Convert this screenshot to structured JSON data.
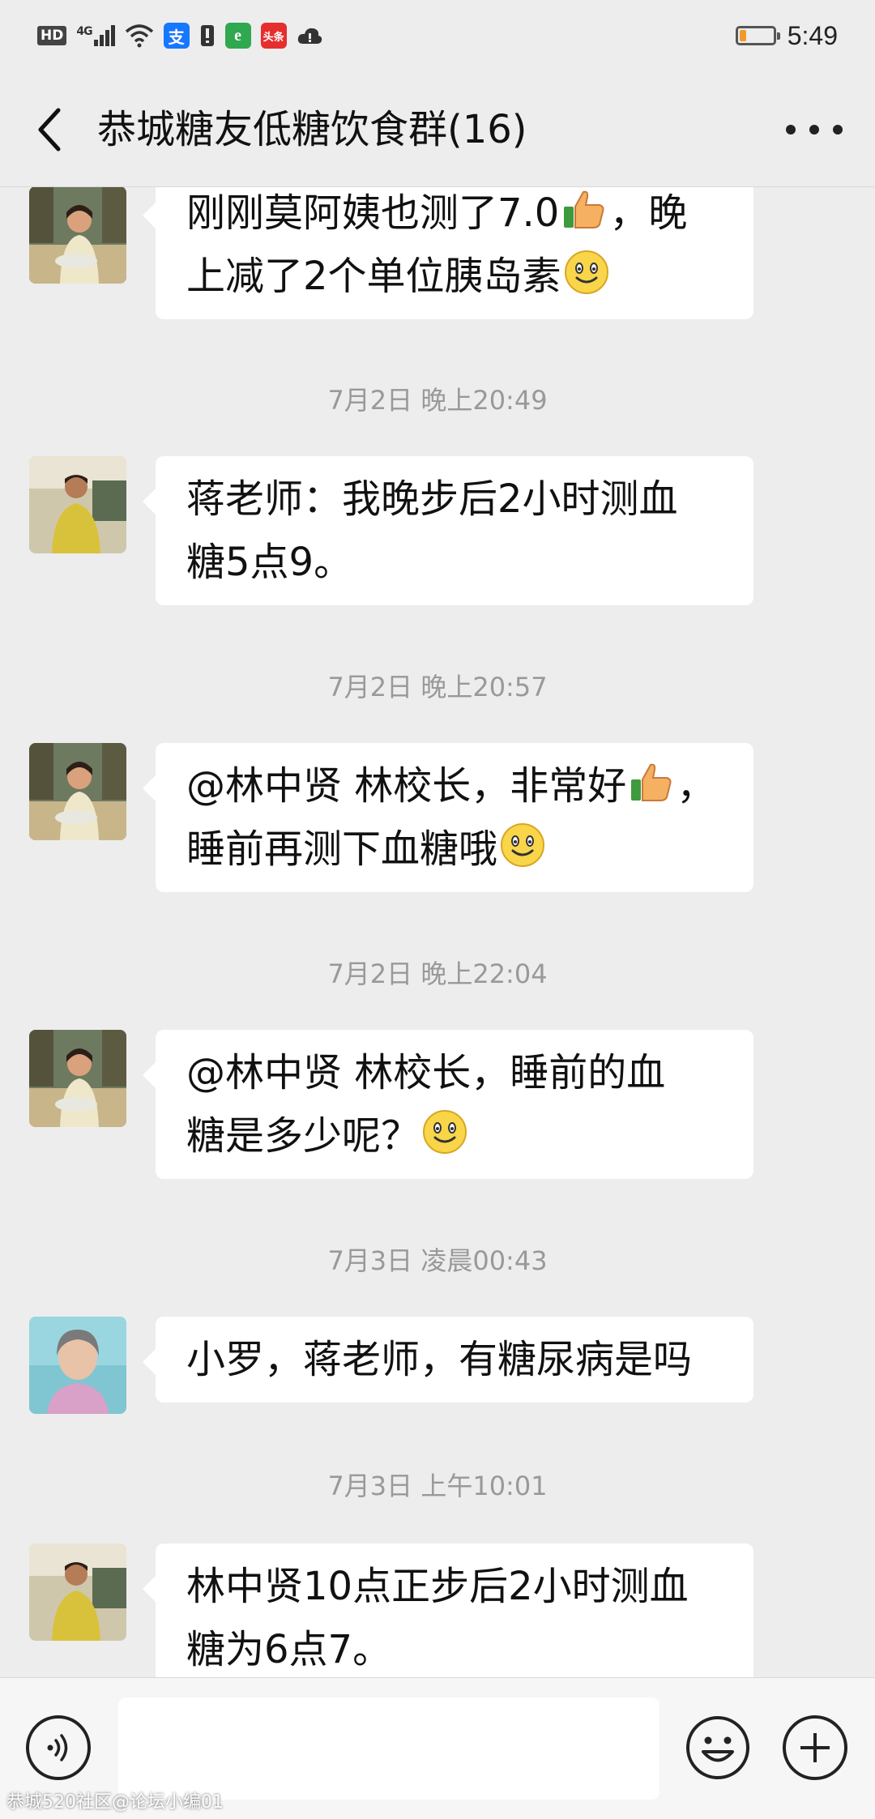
{
  "status_bar": {
    "hd": "HD",
    "network": "4G",
    "alipay_glyph": "支",
    "toutiao": "头条",
    "time": "5:49",
    "battery_level": 0.2,
    "icons": [
      "hd-icon",
      "signal-icon",
      "wifi-icon",
      "alipay-icon",
      "sim-icon",
      "browser-icon",
      "toutiao-icon",
      "cloud-icon",
      "battery-icon"
    ]
  },
  "header": {
    "title": "恭城糖友低糖饮食群(16)",
    "back_icon": "chevron-left-icon",
    "more_icon": "more-dots-icon"
  },
  "messages": [
    {
      "lines": [
        "刚刚莫阿姨也测了7.0",
        "，晚",
        "上减了2个单位胰岛素"
      ],
      "avatar": "woman-in-kitchen"
    },
    {
      "timestamp": "7月2日 晚上20:49"
    },
    {
      "lines": [
        "蒋老师：我晚步后2小时测血",
        "糖5点9。"
      ],
      "avatar": "man-yellow-shirt"
    },
    {
      "timestamp": "7月2日 晚上20:57"
    },
    {
      "lines": [
        "@林中贤  林校长，非常好",
        "，",
        "睡前再测下血糖哦"
      ],
      "avatar": "woman-in-kitchen"
    },
    {
      "timestamp": "7月2日 晚上22:04"
    },
    {
      "lines": [
        "@林中贤  林校长，睡前的血",
        "糖是多少呢？"
      ],
      "avatar": "woman-in-kitchen"
    },
    {
      "timestamp": "7月3日 凌晨00:43"
    },
    {
      "lines": [
        "小罗，蒋老师，有糖尿病是吗"
      ],
      "avatar": "older-woman-portrait"
    },
    {
      "timestamp": "7月3日 上午10:01"
    },
    {
      "lines": [
        "林中贤10点正步后2小时测血",
        "糖为6点7。"
      ],
      "avatar": "man-yellow-shirt"
    }
  ],
  "input_bar": {
    "voice_icon": "voice-icon",
    "emoji_icon": "smiley-icon",
    "plus_icon": "plus-icon"
  },
  "watermark": "恭城520社区@论坛小编01"
}
